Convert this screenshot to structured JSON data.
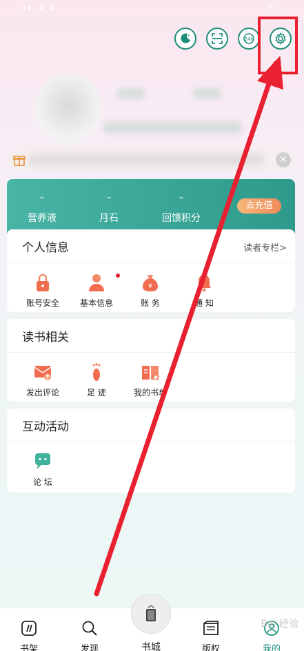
{
  "topbar": {
    "icons": [
      "night-mode-icon",
      "scan-icon",
      "service-24h-icon",
      "settings-icon"
    ],
    "service_label": "24h"
  },
  "wallet": {
    "items": [
      {
        "value": "–",
        "label": "营养液"
      },
      {
        "value": "–",
        "label": "月石"
      },
      {
        "value": "–",
        "label": "回馈积分"
      }
    ],
    "recharge_label": "去充值"
  },
  "personal": {
    "title": "个人信息",
    "more": "读者专栏>",
    "items": [
      {
        "label": "账号安全",
        "icon": "lock-icon"
      },
      {
        "label": "基本信息",
        "icon": "person-icon"
      },
      {
        "label": "账 务",
        "icon": "money-bag-icon"
      },
      {
        "label": "通 知",
        "icon": "bell-icon"
      }
    ]
  },
  "reading": {
    "title": "读书相关",
    "items": [
      {
        "label": "发出评论",
        "icon": "comment-mail-icon"
      },
      {
        "label": "足 迹",
        "icon": "footprint-icon"
      },
      {
        "label": "我的书单",
        "icon": "booklist-icon"
      }
    ]
  },
  "activity": {
    "title": "互动活动",
    "items": [
      {
        "label": "论 坛",
        "icon": "forum-icon"
      }
    ]
  },
  "tabbar": {
    "tabs": [
      {
        "label": "书架"
      },
      {
        "label": "发现"
      },
      {
        "label": "书城"
      },
      {
        "label": "版权"
      },
      {
        "label": "我的"
      }
    ]
  },
  "watermark": "Bai 经验",
  "colors": {
    "primary_green": "#1e8d79",
    "annotation_red": "#e8202f",
    "recharge_orange": "#f08a5a"
  }
}
